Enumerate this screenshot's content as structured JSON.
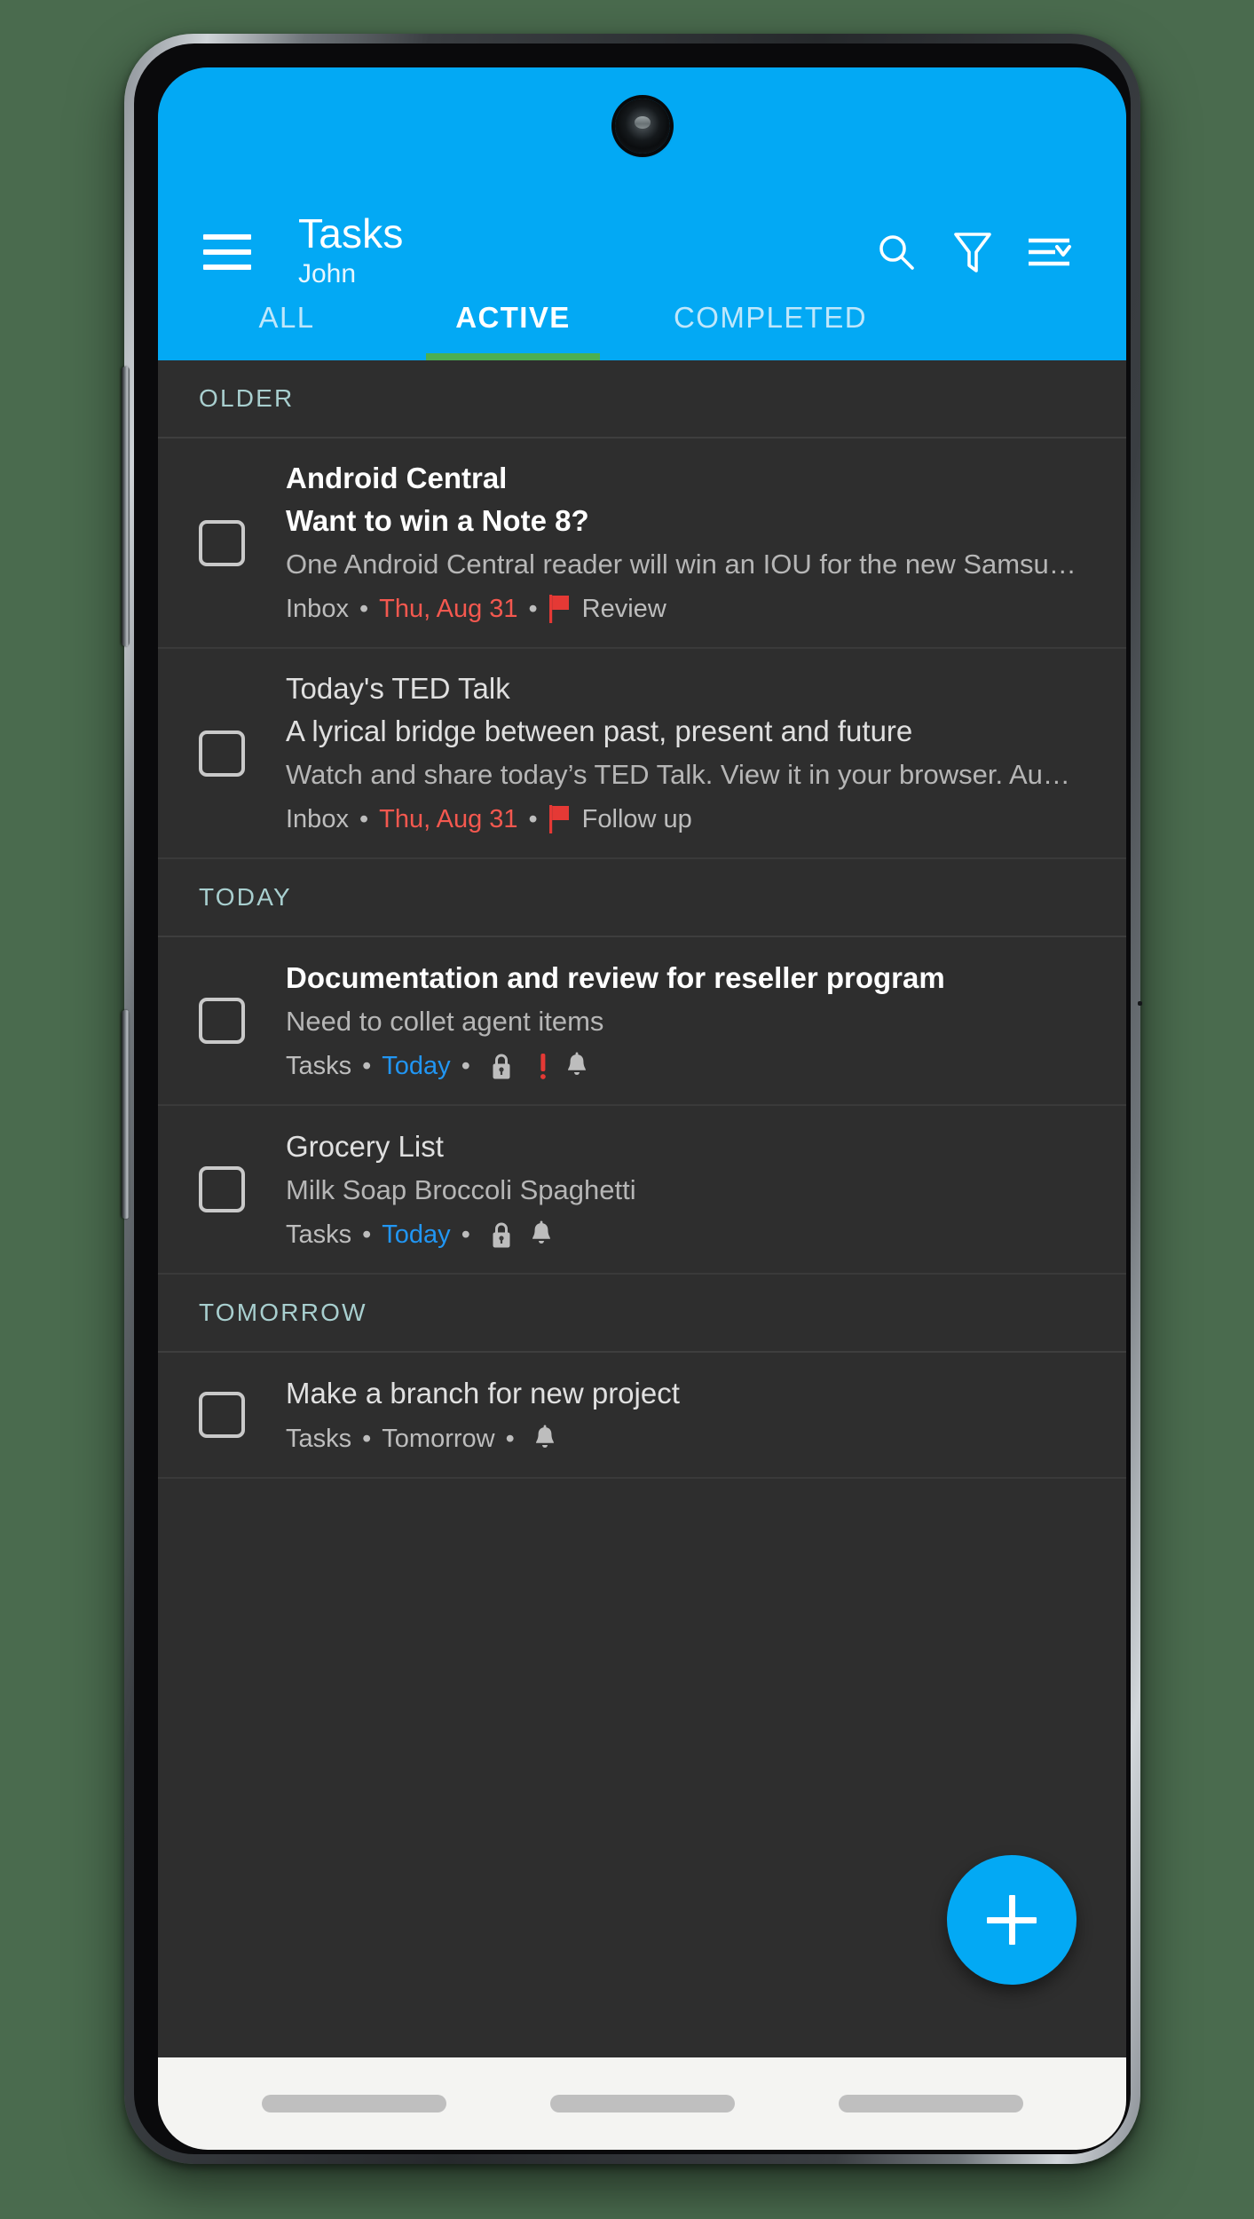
{
  "colors": {
    "accent": "#03A9F4",
    "tab_indicator": "#4CAF50",
    "background": "#2E2E2E",
    "overdue_red": "#F4584F",
    "due_blue": "#2196F3",
    "section_header": "#A8CFCF",
    "flag_red": "#E53935"
  },
  "header": {
    "menu_icon": "hamburger-menu-icon",
    "title": "Tasks",
    "subtitle": "John",
    "actions": [
      {
        "name": "search-icon",
        "label": "Search"
      },
      {
        "name": "filter-icon",
        "label": "Filter"
      },
      {
        "name": "sort-icon",
        "label": "Sort"
      }
    ]
  },
  "tabs": [
    {
      "label": "ALL",
      "active": false
    },
    {
      "label": "ACTIVE",
      "active": true
    },
    {
      "label": "COMPLETED",
      "active": false
    }
  ],
  "sections": [
    {
      "header": "OLDER",
      "tasks": [
        {
          "sender": "Android Central",
          "title": "Want to win a Note 8?",
          "title_bold": true,
          "description": "One Android Central reader will win an IOU for the new Samsu…",
          "meta": {
            "list": "Inbox",
            "due": "Thu, Aug 31",
            "due_style": "red",
            "flag_label": "Review",
            "has_flag": true,
            "has_lock": false,
            "has_priority": false,
            "has_reminder": false
          }
        },
        {
          "sender": "Today's TED Talk",
          "title": "A lyrical bridge between past, present and future",
          "title_bold": false,
          "description": "Watch and share today’s TED Talk. View it in your browser. Au…",
          "meta": {
            "list": "Inbox",
            "due": "Thu, Aug 31",
            "due_style": "red",
            "flag_label": "Follow up",
            "has_flag": true,
            "has_lock": false,
            "has_priority": false,
            "has_reminder": false
          }
        }
      ]
    },
    {
      "header": "TODAY",
      "tasks": [
        {
          "sender": "",
          "title": "Documentation and review for reseller program",
          "title_bold": true,
          "description": "Need to collet agent items",
          "meta": {
            "list": "Tasks",
            "due": "Today",
            "due_style": "blue",
            "flag_label": "",
            "has_flag": false,
            "has_lock": true,
            "has_priority": true,
            "has_reminder": true
          }
        },
        {
          "sender": "",
          "title": "Grocery List",
          "title_bold": false,
          "description": "Milk Soap Broccoli Spaghetti",
          "meta": {
            "list": "Tasks",
            "due": "Today",
            "due_style": "blue",
            "flag_label": "",
            "has_flag": false,
            "has_lock": true,
            "has_priority": false,
            "has_reminder": true
          }
        }
      ]
    },
    {
      "header": "TOMORROW",
      "tasks": [
        {
          "sender": "",
          "title": "Make a branch for new project",
          "title_bold": false,
          "description": "",
          "meta": {
            "list": "Tasks",
            "due": "Tomorrow",
            "due_style": "plain",
            "flag_label": "",
            "has_flag": false,
            "has_lock": false,
            "has_priority": false,
            "has_reminder": true
          }
        }
      ]
    }
  ],
  "fab": {
    "icon": "plus-icon",
    "label": "Add task"
  },
  "bottom_nav": [
    {
      "name": "nav-recents-pill"
    },
    {
      "name": "nav-home-pill"
    },
    {
      "name": "nav-back-pill"
    }
  ],
  "separator": "•"
}
